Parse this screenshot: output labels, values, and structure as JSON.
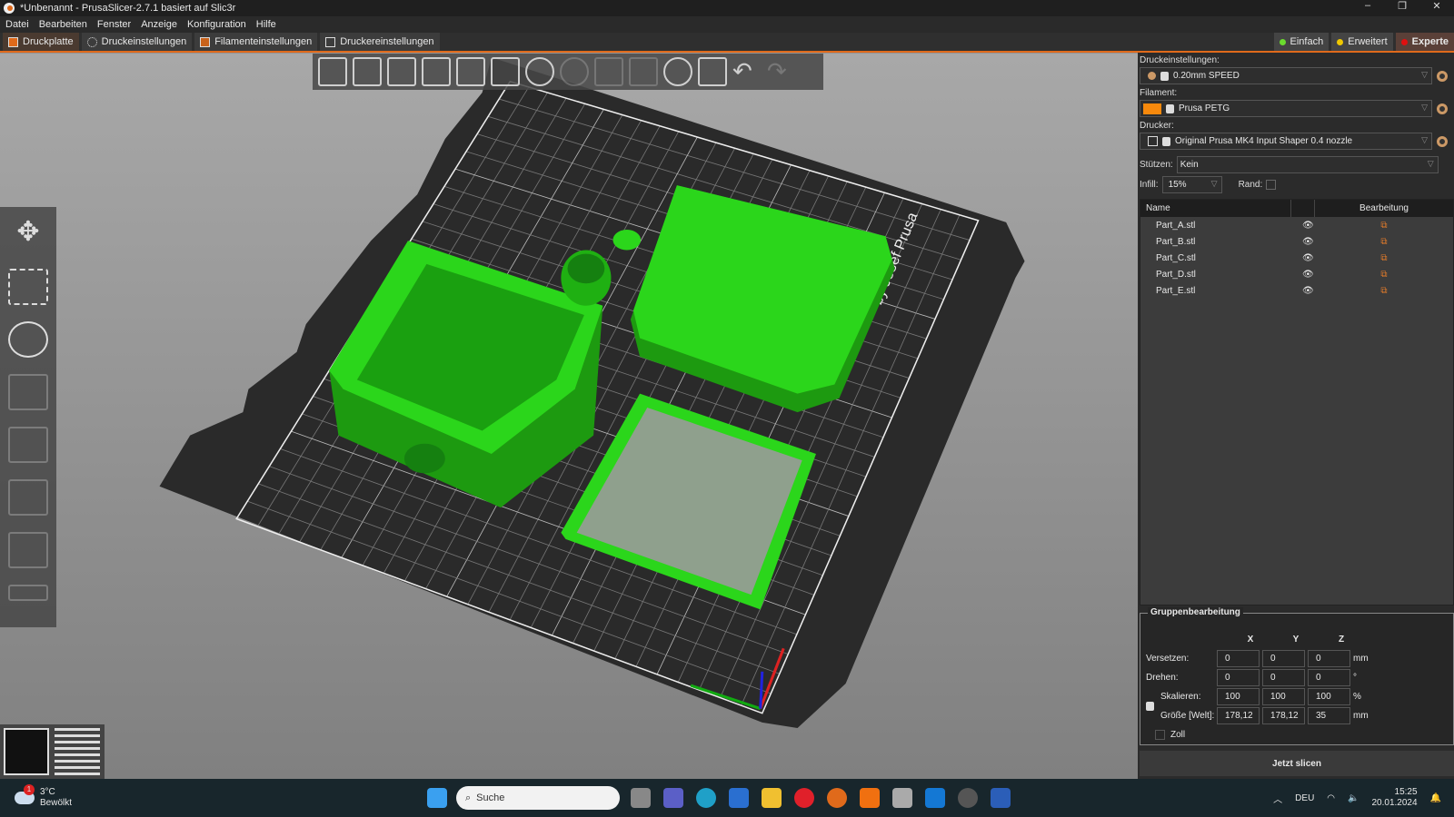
{
  "window": {
    "title": "*Unbenannt - PrusaSlicer-2.7.1 basiert auf Slic3r",
    "minimize": "–",
    "maximize": "❐",
    "close": "✕"
  },
  "menu": [
    "Datei",
    "Bearbeiten",
    "Fenster",
    "Anzeige",
    "Konfiguration",
    "Hilfe"
  ],
  "tabs": [
    {
      "label": "Druckplatte",
      "active": true
    },
    {
      "label": "Druckeinstellungen"
    },
    {
      "label": "Filamenteinstellungen"
    },
    {
      "label": "Druckereinstellungen"
    }
  ],
  "modes": [
    {
      "label": "Einfach",
      "color": "#6bdc2e"
    },
    {
      "label": "Erweitert",
      "color": "#f0c800"
    },
    {
      "label": "Experte",
      "color": "#e01010",
      "active": true
    }
  ],
  "toolbar": [
    "add-icon",
    "delete-icon",
    "delete-all-icon",
    "arrange-icon",
    "copy-icon",
    "paste-icon",
    "add-instance-icon",
    "remove-instance-icon",
    "split-objects-icon",
    "split-parts-icon",
    "search-icon",
    "layers-editing-icon",
    "undo-icon",
    "redo-icon"
  ],
  "left_tools": [
    "move-icon",
    "scale-icon",
    "rotate-icon",
    "place-on-face-icon",
    "cut-icon",
    "hollow-icon",
    "support-paint-icon",
    "seam-paint-icon",
    "measure-icon"
  ],
  "settings": {
    "print_label": "Druckeinstellungen:",
    "print_value": "0.20mm SPEED",
    "filament_label": "Filament:",
    "filament_value": "Prusa PETG",
    "filament_color": "#f7890c",
    "printer_label": "Drucker:",
    "printer_value": "Original Prusa MK4 Input Shaper 0.4 nozzle",
    "supports_label": "Stützen:",
    "supports_value": "Kein",
    "infill_label": "Infill:",
    "infill_value": "15%",
    "brim_label": "Rand:",
    "brim_checked": false
  },
  "objects": {
    "col_name": "Name",
    "col_edit": "Bearbeitung",
    "items": [
      "Part_A.stl",
      "Part_B.stl",
      "Part_C.stl",
      "Part_D.stl",
      "Part_E.stl"
    ]
  },
  "group": {
    "title": "Gruppenbearbeitung",
    "axes": [
      "X",
      "Y",
      "Z"
    ],
    "rows": [
      {
        "label": "Versetzen:",
        "values": [
          "0",
          "0",
          "0"
        ],
        "unit": "mm"
      },
      {
        "label": "Drehen:",
        "values": [
          "0",
          "0",
          "0"
        ],
        "unit": "°"
      },
      {
        "label": "Skalieren:",
        "values": [
          "100",
          "100",
          "100"
        ],
        "unit": "%"
      },
      {
        "label": "Größe [Welt]:",
        "values": [
          "178,12",
          "178,12",
          "35"
        ],
        "unit": "mm"
      }
    ],
    "inches_label": "Zoll"
  },
  "slice_button": "Jetzt slicen",
  "bed_text": "by Josef Prusa",
  "object_color": "#22c814",
  "taskbar": {
    "weather_temp": "3°C",
    "weather_desc": "Bewölkt",
    "weather_badge": "1",
    "search_placeholder": "Suche",
    "lang": "DEU",
    "time": "15:25",
    "date": "20.01.2024"
  }
}
